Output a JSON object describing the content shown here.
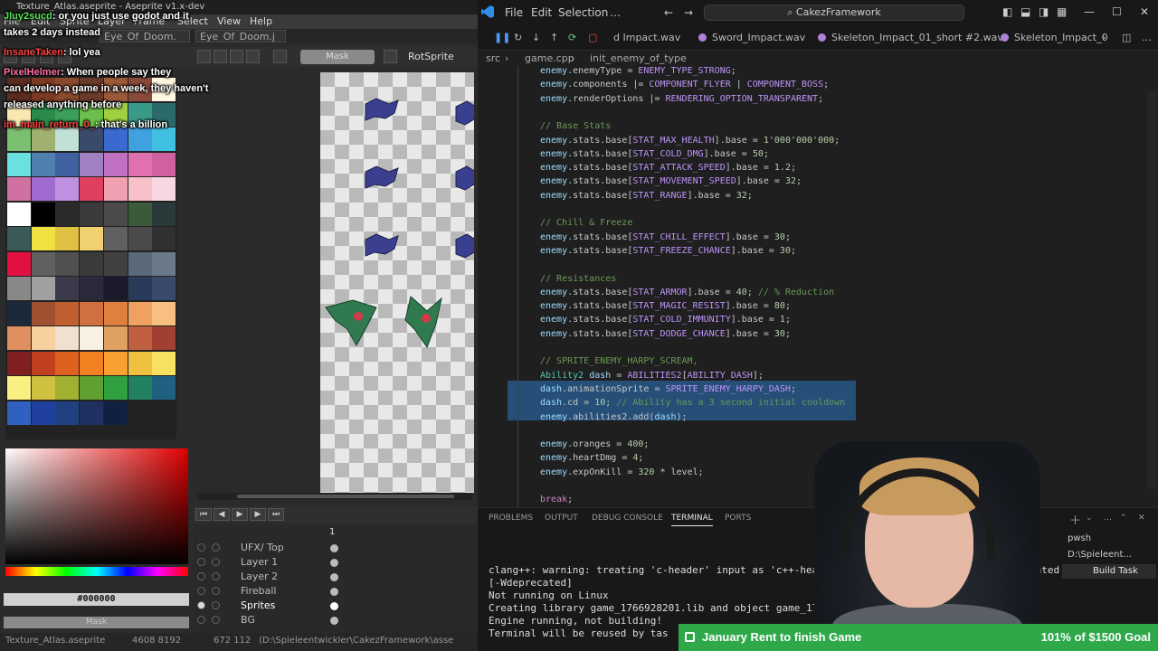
{
  "aseprite": {
    "title": "Texture_Atlas.aseprite - Aseprite v1.x-dev",
    "menu": [
      "File",
      "Edit",
      "Sprite",
      "Layer",
      "Frame",
      "Select",
      "View",
      "Help"
    ],
    "tabs": [
      "Eye_Of_Doom.",
      "Eye_Of_Doom.j"
    ],
    "toolbar": {
      "mask_label": "Mask",
      "rotsprite": "RotSprite"
    },
    "color_hex": "#000000",
    "mask_label": "Mask",
    "timeline_frame": "1",
    "layers": [
      "UFX/ Top",
      "Layer 1",
      "Layer 2",
      "Fireball",
      "Sprites",
      "BG"
    ],
    "status": {
      "file": "Texture_Atlas.aseprite",
      "size": "4608 8192",
      "pos": "672 112",
      "path": "(D:\\Spieleentwickler\\CakezFramework\\asse"
    },
    "palette_colors": [
      "#5a2b1f",
      "#7a3a24",
      "#8a4a2c",
      "#6a3a2a",
      "#9a5a3a",
      "#8a4a3a",
      "#fff8e0",
      "#f8e8b0",
      "#2a8a4a",
      "#3aa05a",
      "#6ac04a",
      "#a0d040",
      "#3a9a8a",
      "#2a6a6a",
      "#7ac070",
      "#a0b070",
      "#c0e0d8",
      "#3a4a6a",
      "#3a6ad0",
      "#40a0e0",
      "#40c0e0",
      "#6ae0e0",
      "#5080b0",
      "#4060a0",
      "#a080c0",
      "#c070c0",
      "#e070b0",
      "#d060a0",
      "#d070a0",
      "#a06ad0",
      "#c090e0",
      "#e04060",
      "#f0a0b0",
      "#f8c0c8",
      "#f8d8e0",
      "#ffffff",
      "#000000",
      "#2a2a2a",
      "#3a3a3a",
      "#4a4a4a",
      "#3a5a3a",
      "#2a3a3a",
      "#3a5a5a",
      "#f0e040",
      "#e0c040",
      "#f0d070",
      "#606060",
      "#4a4a4a",
      "#303030",
      "#e01040",
      "#606060",
      "#505050",
      "#3a3a3a",
      "#404040",
      "#5a6a7a",
      "#6a7a8a",
      "#888888",
      "#a0a0a0",
      "#3a3a4a",
      "#2a2a3a",
      "#1a1a2a",
      "#2a3a5a",
      "#3a4a6a",
      "#1a2a3a",
      "#a05030",
      "#c06030",
      "#d07040",
      "#e08040",
      "#f0a060",
      "#f8c080",
      "#e09060",
      "#f8d0a0",
      "#f0e0d0",
      "#f8f0e0",
      "#e0a060",
      "#c06040",
      "#a04030",
      "#802020",
      "#c04020",
      "#e06020",
      "#f08020",
      "#f8a030",
      "#f0c040",
      "#f8e060",
      "#f8f080",
      "#d0c040",
      "#a0b030",
      "#60a030",
      "#30a040",
      "#208060",
      "#206080",
      "#3060c0",
      "#2040a0",
      "#204080",
      "#203060",
      "#102040"
    ]
  },
  "chat": [
    {
      "user": "Jluy2sucd",
      "text": ": or you just use godot and it"
    },
    {
      "user": "",
      "text": "takes 2 days instead"
    },
    {
      "user": "InsaneTaken",
      "text": ": lol yea"
    },
    {
      "user": "PixelHelmer",
      "text": ": When people say they"
    },
    {
      "user": "",
      "text": "can develop a game in a week, they haven't"
    },
    {
      "user": "",
      "text": "released anything before"
    },
    {
      "user": "im_main_return_0_",
      "text": ": that's a billion"
    }
  ],
  "vscode": {
    "menu": [
      "File",
      "Edit",
      "Selection",
      "…"
    ],
    "search": "CakezFramework",
    "tabs": [
      "d Impact.wav",
      "Sword_Impact.wav",
      "Skeleton_Impact_01_short #2.wav",
      "Skeleton_Impact_0"
    ],
    "breadcrumbs": [
      "src",
      "game.cpp",
      "init_enemy_of_type"
    ],
    "panel_tabs": [
      "PROBLEMS",
      "OUTPUT",
      "DEBUG CONSOLE",
      "TERMINAL",
      "PORTS"
    ],
    "terminal": [
      "clang++: warning: treating 'c-header' input as 'c++-header' w",
      " [-Wdeprecated]",
      "Not running on Linux",
      "   Creating library game_1766928201.lib and object game_1766",
      "Engine running, not building!",
      " Terminal will be reused by tas"
    ],
    "terminal_side": [
      "pwsh",
      "D:\\Spieleent...",
      "Build  Task"
    ],
    "terminal_tail": "cated",
    "code": [
      "enemy.enemyType = ENEMY_TYPE_STRONG;",
      "enemy.components |= COMPONENT_FLYER | COMPONENT_BOSS;",
      "enemy.renderOptions |= RENDERING_OPTION_TRANSPARENT;",
      "",
      "// Base Stats",
      "enemy.stats.base[STAT_MAX_HEALTH].base = 1'000'000'000;",
      "enemy.stats.base[STAT_COLD_DMG].base = 50;",
      "enemy.stats.base[STAT_ATTACK_SPEED].base = 1.2;",
      "enemy.stats.base[STAT_MOVEMENT_SPEED].base = 32;",
      "enemy.stats.base[STAT_RANGE].base = 32;",
      "",
      "// Chill & Freeze",
      "enemy.stats.base[STAT_CHILL_EFFECT].base = 30;",
      "enemy.stats.base[STAT_FREEZE_CHANCE].base = 30;",
      "",
      "// Resistances",
      "enemy.stats.base[STAT_ARMOR].base = 40; // % Reduction",
      "enemy.stats.base[STAT_MAGIC_RESIST].base = 80;",
      "enemy.stats.base[STAT_COLD_IMMUNITY].base = 1;",
      "enemy.stats.base[STAT_DODGE_CHANCE].base = 30;",
      "",
      "// SPRITE_ENEMY_HARPY_SCREAM,",
      "Ability2 dash = ABILITIES2[ABILITY_DASH];",
      "dash.animationSprite = SPRITE_ENEMY_HARPY_DASH;",
      "dash.cd = 10; // Ability has a 3 second initial cooldown",
      "enemy.abilities2.add(dash);",
      "",
      "enemy.oranges = 400;",
      "enemy.heartDmg = 4;",
      "enemy.expOnKill = 320 * level;",
      "",
      "break;"
    ]
  },
  "goal": {
    "label": "January Rent to finish Game",
    "value": "101% of $1500 Goal"
  }
}
